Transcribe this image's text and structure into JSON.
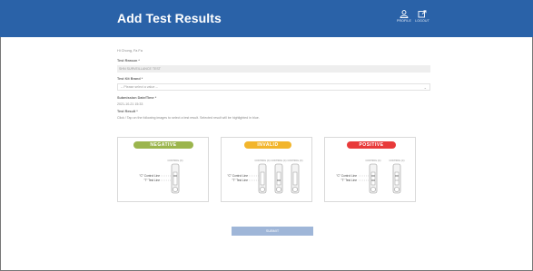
{
  "header": {
    "title": "Add Test Results",
    "profile_label": "PROFILE",
    "logout_label": "LOGOUT",
    "bg_color": "#2a62a8"
  },
  "form": {
    "greeting": "Hi Chong, Fa Fa",
    "test_reason": {
      "label": "Test Reason *",
      "value": "SHN SURVEILLANCE TEST"
    },
    "test_kit_brand": {
      "label": "Test Kit Brand *",
      "value": "-- Please select a value --"
    },
    "submission_datetime": {
      "label": "Submission Date/Time *",
      "value": "2021-10-21 15:33"
    },
    "test_result": {
      "label": "Test Result *",
      "hint": "Click / Tap on the following images to select a test result. Selected result will be highlighted in blue."
    }
  },
  "results": [
    {
      "name": "NEGATIVE",
      "color": "#9bb54d",
      "control_label": "\"C\" Control Line",
      "test_label": "\"T\" Test Line",
      "strip_marks": [
        "CONTROL (C)"
      ]
    },
    {
      "name": "INVALID",
      "color": "#f2b52c",
      "control_label": "\"C\" Control Line",
      "test_label": "\"T\" Test Line",
      "strip_marks": [
        "CONTROL (C)",
        "CONTROL (C)",
        "CONTROL (C)"
      ]
    },
    {
      "name": "POSITIVE",
      "color": "#e83a3a",
      "control_label": "\"C\" Control Line",
      "test_label": "\"T\" Test Line",
      "strip_marks": [
        "CONTROL (C)",
        "CONTROL (C)"
      ]
    }
  ],
  "submit_label": "SUBMIT"
}
